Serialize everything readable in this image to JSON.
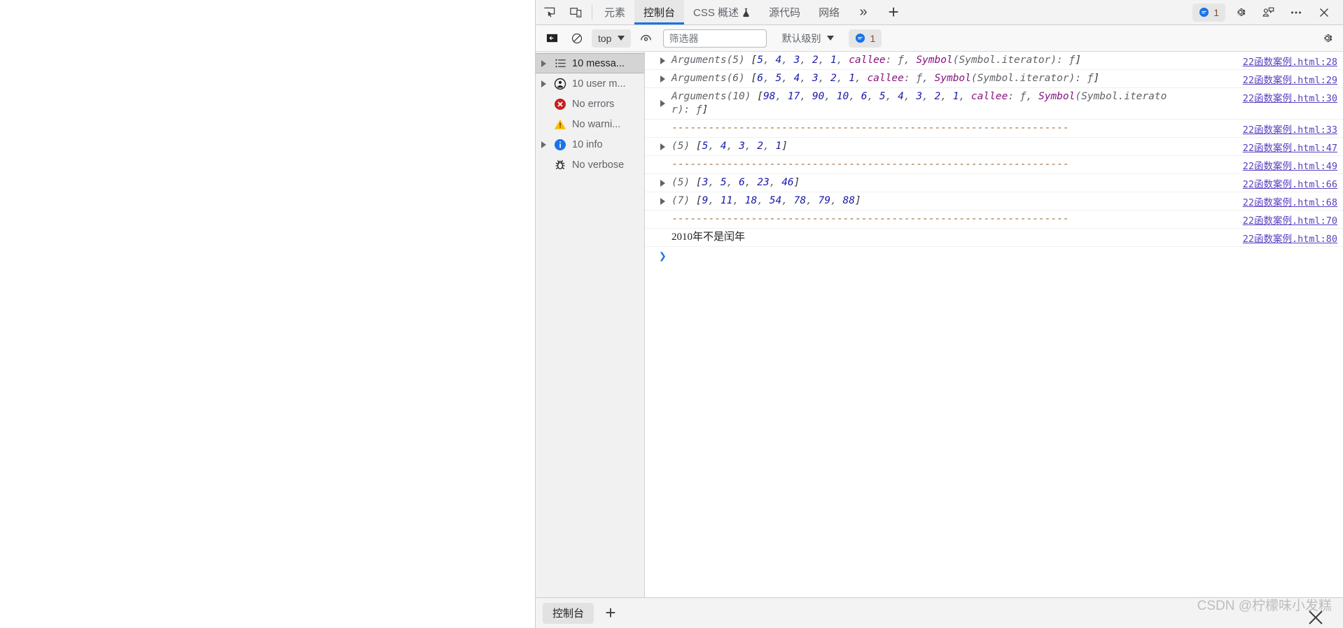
{
  "window": {
    "tabbar": {
      "inspect_icon": "inspect-element-icon",
      "device_icon": "device-toolbar-icon",
      "tabs": [
        {
          "label": "元素",
          "active": false,
          "name": "tab-elements"
        },
        {
          "label": "控制台",
          "active": true,
          "name": "tab-console"
        },
        {
          "label": "CSS 概述",
          "active": false,
          "name": "tab-css-overview",
          "badge": "experiment-flask-icon"
        },
        {
          "label": "源代码",
          "active": false,
          "name": "tab-sources"
        },
        {
          "label": "网络",
          "active": false,
          "name": "tab-network"
        }
      ],
      "more_tabs_label": "»",
      "add_tab_label": "+",
      "message_badge_count": "1",
      "settings_icon": "gear-icon",
      "feedback_icon": "feedback-icon",
      "more_options_icon": "more-options-icon",
      "close_icon": "close-icon"
    },
    "filterbar": {
      "sidebar_toggle_icon": "show-console-sidebar-icon",
      "clear_icon": "clear-console-icon",
      "context_value": "top",
      "eye_icon": "live-expression-icon",
      "filter_value": "",
      "filter_placeholder": "筛选器",
      "level_value": "默认级别",
      "issues_count": "1",
      "settings_icon": "gear-icon"
    },
    "sidebar": {
      "items": [
        {
          "label": "10 messa...",
          "icon": "list-icon",
          "expandable": true,
          "selected": true,
          "name": "sidebar-item-messages"
        },
        {
          "label": "10 user m...",
          "icon": "user-message-icon",
          "expandable": true,
          "selected": false,
          "name": "sidebar-item-user-messages"
        },
        {
          "label": "No errors",
          "icon": "error-icon",
          "expandable": false,
          "selected": false,
          "name": "sidebar-item-errors"
        },
        {
          "label": "No warni...",
          "icon": "warning-icon",
          "expandable": false,
          "selected": false,
          "name": "sidebar-item-warnings"
        },
        {
          "label": "10 info",
          "icon": "info-icon",
          "expandable": true,
          "selected": false,
          "name": "sidebar-item-info"
        },
        {
          "label": "No verbose",
          "icon": "bug-icon",
          "expandable": false,
          "selected": false,
          "name": "sidebar-item-verbose"
        }
      ]
    },
    "console": {
      "rows": [
        {
          "kind": "object",
          "expandable": true,
          "prefix": "Arguments(5) ",
          "body": "[5, 4, 3, 2, 1, callee: ƒ, Symbol(Symbol.iterator): ƒ]",
          "source": "22函数案例.html:28",
          "source_align": "top"
        },
        {
          "kind": "object",
          "expandable": true,
          "prefix": "Arguments(6) ",
          "body": "[6, 5, 4, 3, 2, 1, callee: ƒ, Symbol(Symbol.iterator): ƒ]",
          "source": "22函数案例.html:29",
          "source_align": "top"
        },
        {
          "kind": "object",
          "expandable": true,
          "prefix": "Arguments(10) ",
          "body": "[98, 17, 90, 10, 6, 5, 4, 3, 2, 1, callee: ƒ, Symbol(Symbol.iterator): ƒ]",
          "source": "22函数案例.html:30",
          "source_align": "top",
          "wrap": true
        },
        {
          "kind": "dashes",
          "expandable": false,
          "prefix": "",
          "body": "-----------------------------------------------------------------",
          "source": "22函数案例.html:33",
          "source_align": "top"
        },
        {
          "kind": "object",
          "expandable": true,
          "prefix": "(5) ",
          "body": "[5, 4, 3, 2, 1]",
          "source": "22函数案例.html:47",
          "source_align": "top"
        },
        {
          "kind": "dashes",
          "expandable": false,
          "prefix": "",
          "body": "-----------------------------------------------------------------",
          "source": "22函数案例.html:49",
          "source_align": "top"
        },
        {
          "kind": "object",
          "expandable": true,
          "prefix": "(5) ",
          "body": "[3, 5, 6, 23, 46]",
          "source": "22函数案例.html:66",
          "source_align": "top"
        },
        {
          "kind": "object",
          "expandable": true,
          "prefix": "(7) ",
          "body": "[9, 11, 18, 54, 78, 79, 88]",
          "source": "22函数案例.html:68",
          "source_align": "top"
        },
        {
          "kind": "dashes",
          "expandable": false,
          "prefix": "",
          "body": "-----------------------------------------------------------------",
          "source": "22函数案例.html:70",
          "source_align": "top"
        },
        {
          "kind": "text",
          "expandable": false,
          "prefix": "",
          "body": "2010年不是闰年",
          "source": "22函数案例.html:80",
          "source_align": "top"
        }
      ],
      "prompt_caret": "❯"
    },
    "drawer": {
      "tab_label": "控制台",
      "add_label": "+"
    },
    "watermark": "CSDN @柠檬味小发糕"
  },
  "colors": {
    "accent": "#1a73e8",
    "error": "#d93025",
    "warning": "#fbbc04",
    "info": "#1a73e8",
    "link": "#5a3fc0",
    "number": "#1a1aa6",
    "property": "#881280",
    "dash": "#9a6b3f"
  }
}
